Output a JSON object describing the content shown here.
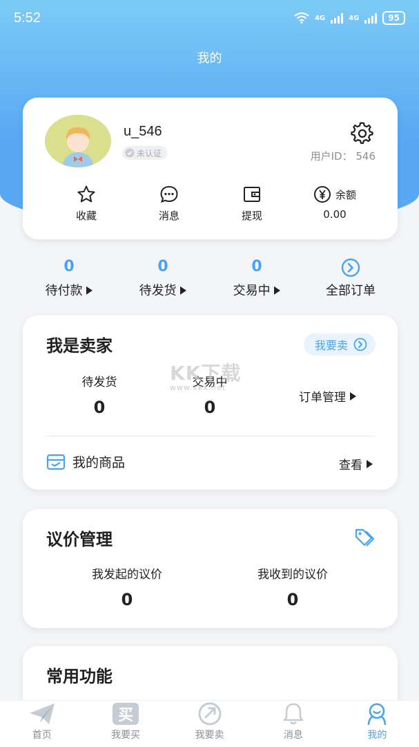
{
  "status": {
    "time": "5:52",
    "network1": "4G",
    "network2": "4G",
    "battery": "95"
  },
  "header": {
    "title": "我的"
  },
  "profile": {
    "username": "u_546",
    "verify_badge": "未认证",
    "user_id_label": "用户ID：",
    "user_id": "546",
    "quick": [
      {
        "label": "收藏",
        "icon": "star-icon"
      },
      {
        "label": "消息",
        "icon": "chat-icon"
      },
      {
        "label": "提现",
        "icon": "wallet-icon"
      },
      {
        "label": "余额",
        "icon": "yuan-icon",
        "value": "0.00"
      }
    ]
  },
  "orders": [
    {
      "count": "0",
      "label": "待付款"
    },
    {
      "count": "0",
      "label": "待发货"
    },
    {
      "count": "0",
      "label": "交易中"
    },
    {
      "label": "全部订单"
    }
  ],
  "seller": {
    "title": "我是卖家",
    "sell_button": "我要卖",
    "stats": [
      {
        "label": "待发货",
        "value": "0"
      },
      {
        "label": "交易中",
        "value": "0"
      }
    ],
    "order_manage": "订单管理",
    "my_goods": "我的商品",
    "view": "查看"
  },
  "watermark": {
    "text": "KK下载",
    "sub": "www.kkx.net"
  },
  "negotiate": {
    "title": "议价管理",
    "stats": [
      {
        "label": "我发起的议价",
        "value": "0"
      },
      {
        "label": "我收到的议价",
        "value": "0"
      }
    ]
  },
  "common": {
    "title": "常用功能"
  },
  "tabs": [
    {
      "label": "首页",
      "icon": "paper-plane-icon"
    },
    {
      "label": "我要买",
      "icon": "buy-icon",
      "glyph": "买"
    },
    {
      "label": "我要卖",
      "icon": "sell-icon"
    },
    {
      "label": "消息",
      "icon": "bell-icon"
    },
    {
      "label": "我的",
      "icon": "profile-icon",
      "active": true
    }
  ],
  "colors": {
    "accent": "#4aa3f2",
    "hero_top": "#7ccbf6",
    "hero_bottom": "#5aa8f3"
  }
}
